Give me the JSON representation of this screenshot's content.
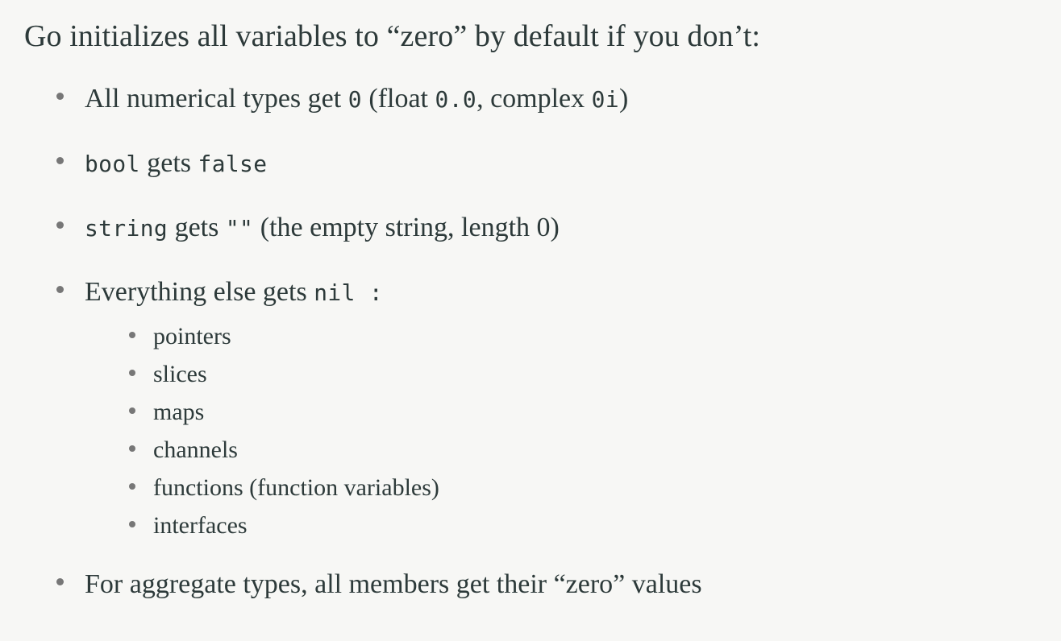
{
  "slide": {
    "background_color": "#f7f7f5",
    "text_color": "#2d3a3a",
    "bullet_color": "#777777",
    "heading": "Go initializes all variables to “zero” by default if you don’t:",
    "bullets": [
      {
        "id": "numerical-types",
        "parts": [
          {
            "kind": "text",
            "value": "All numerical types get "
          },
          {
            "kind": "code",
            "value": "0"
          },
          {
            "kind": "text",
            "value": " (float "
          },
          {
            "kind": "code",
            "value": "0.0"
          },
          {
            "kind": "text",
            "value": ", complex "
          },
          {
            "kind": "code",
            "value": "0i"
          },
          {
            "kind": "text",
            "value": ")"
          }
        ],
        "plain": "All numerical types get 0 (float 0.0, complex 0i)"
      },
      {
        "id": "bool",
        "parts": [
          {
            "kind": "code",
            "value": "bool"
          },
          {
            "kind": "text",
            "value": " gets "
          },
          {
            "kind": "code",
            "value": "false"
          }
        ],
        "plain": "bool gets false"
      },
      {
        "id": "string",
        "parts": [
          {
            "kind": "code",
            "value": "string"
          },
          {
            "kind": "text",
            "value": " gets "
          },
          {
            "kind": "code",
            "value": "\"\""
          },
          {
            "kind": "text",
            "value": " (the empty string, length 0)"
          }
        ],
        "plain": "string gets \"\" (the empty string, length 0)"
      },
      {
        "id": "everything-else",
        "parts": [
          {
            "kind": "text",
            "value": "Everything else gets "
          },
          {
            "kind": "code",
            "value": "nil"
          },
          {
            "kind": "code",
            "value": " :"
          }
        ],
        "plain": "Everything else gets nil :"
      },
      {
        "id": "aggregate-types",
        "parts": [
          {
            "kind": "text",
            "value": "For aggregate types, all members get their “zero” values"
          }
        ],
        "plain": "For aggregate types, all members get their “zero” values"
      }
    ],
    "sub_bullets": [
      {
        "id": "pointers",
        "label": "pointers"
      },
      {
        "id": "slices",
        "label": "slices"
      },
      {
        "id": "maps",
        "label": "maps"
      },
      {
        "id": "channels",
        "label": "channels"
      },
      {
        "id": "functions",
        "label": "functions (function variables)"
      },
      {
        "id": "interfaces",
        "label": "interfaces"
      }
    ]
  }
}
